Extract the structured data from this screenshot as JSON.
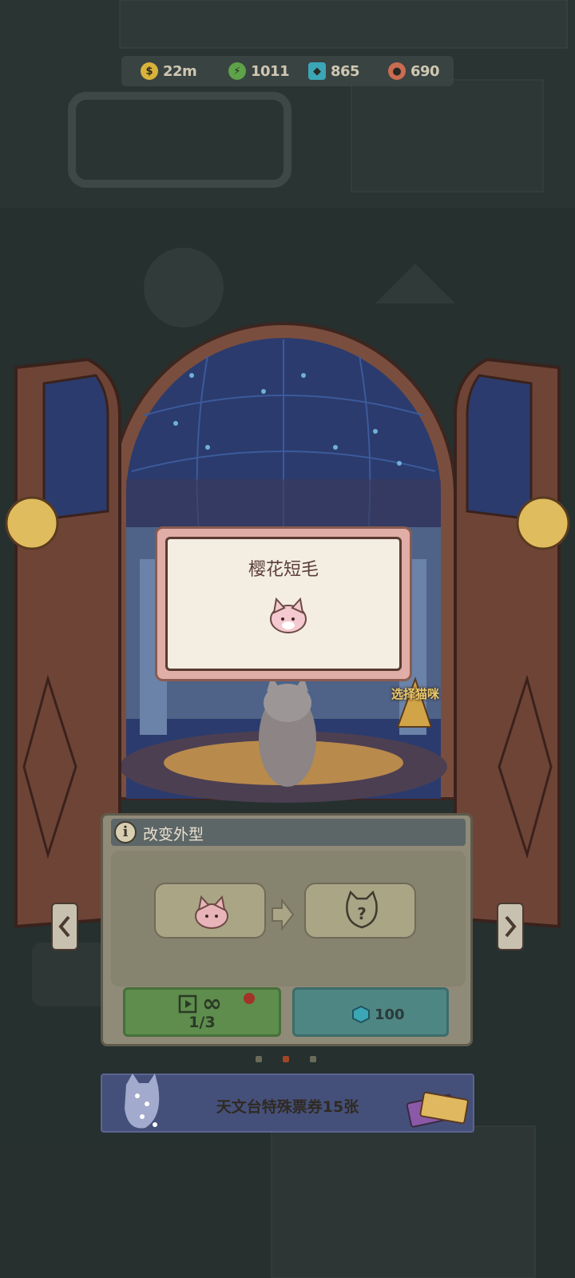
{
  "resources": [
    {
      "icon": "coin-icon",
      "value": "22m",
      "color": "#d8b23a"
    },
    {
      "icon": "lightning-icon",
      "value": "1011",
      "color": "#5ea24a"
    },
    {
      "icon": "gem-icon",
      "value": "865",
      "color": "#3ba6b6"
    },
    {
      "icon": "cat-token-icon",
      "value": "690",
      "color": "#c96c52"
    }
  ],
  "card": {
    "title": "樱花短毛"
  },
  "select_cat_label": "选择猫咪",
  "panel": {
    "title": "改变外型",
    "from_icon": "pink-cat-face-icon",
    "to_icon": "unknown-cat-icon"
  },
  "buttons": {
    "ad": {
      "infinity": "∞",
      "count": "1/3"
    },
    "gem": {
      "value": "100"
    }
  },
  "pager": {
    "pages": 3,
    "active": 1
  },
  "banner": {
    "text": "天文台特殊票券15张"
  },
  "colors": {
    "accent": "#a14527",
    "panel": "#8f8b78",
    "green_button": "#5e8d4d",
    "teal_button": "#4e8683"
  }
}
